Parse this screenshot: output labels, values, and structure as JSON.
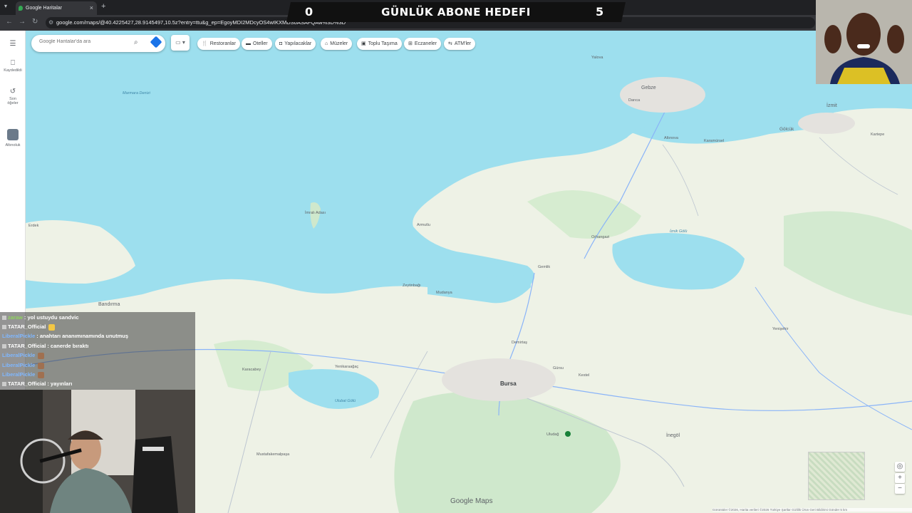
{
  "browser": {
    "tab_title": "Google Haritalar",
    "url_main": "google.com/maps/@40.4225427,28.9145497,10.5z?entry=ttu&g_ep=EgoyMDI2MDcyOS4wIKXMDSoASAFQAw%3D%3D"
  },
  "overlay": {
    "goal_current": "0",
    "goal_title": "GÜNLÜK ABONE HEDEFI",
    "goal_target": "5"
  },
  "rail": {
    "menu": "",
    "saved": "Kaydedildi",
    "recent_line1": "Son",
    "recent_line2": "öğeler",
    "app": "Altınoluk"
  },
  "search": {
    "placeholder": "Google Haritalar'da ara"
  },
  "chips": [
    {
      "label": "Restoranlar",
      "icon": "fork-knife-icon"
    },
    {
      "label": "Oteller",
      "icon": "bed-icon"
    },
    {
      "label": "Yapılacaklar",
      "icon": "camera-icon"
    },
    {
      "label": "Müzeler",
      "icon": "museum-icon"
    },
    {
      "label": "Toplu Taşıma",
      "icon": "train-icon"
    },
    {
      "label": "Eczaneler",
      "icon": "pharmacy-icon"
    },
    {
      "label": "ATM'ler",
      "icon": "atm-icon"
    }
  ],
  "map": {
    "cities": {
      "bursa": "Bursa",
      "izmit": "İzmit",
      "gebze": "Gebze",
      "bandirma": "Bandırma",
      "inegol": "İnegöl",
      "golcuk": "Gölcük"
    },
    "places": {
      "marmara_denizi": "Marmara Denizi",
      "imrali": "İmralı Adası",
      "mudanya": "Mudanya",
      "gemlik": "Gemlik",
      "yalova": "Yalova",
      "uludag": "Uludağ",
      "iznik_golu": "İznik Gölü",
      "ulubat_golu": "Ulubat Gölü",
      "armutlu": "Armutlu",
      "karacabey": "Karacabey",
      "orhangazi": "Orhangazi",
      "gursu": "Gürsu",
      "kestel": "Kestel",
      "yenisehir": "Yenişehir",
      "mustafakemalpasa": "Mustafakemalpaşa",
      "kartepe": "Kartepe",
      "erdek": "Erdek",
      "darica": "Darıca",
      "karamursel": "Karamürsel",
      "altinova": "Altınova",
      "tavsanli": "Yenikaraağaç",
      "osmangazi": "Demirtaş",
      "zeytinbagi": "Zeytinbağı"
    },
    "logo": "Google Maps",
    "attribution": "Görüntüler ©2026, Harita verileri ©2026   Türkiye   Şartlar   Gizlilik   Ürün Geri Bildirimi Gönder   5 km"
  },
  "chat": [
    {
      "user": "zaraw",
      "user_color": "green",
      "msg": ": yol ustuydu sandvic",
      "emote": false
    },
    {
      "user": "TATAR_Official",
      "user_color": "white",
      "msg": "",
      "emote": true
    },
    {
      "user": "LiberalPickle",
      "user_color": "blue",
      "msg": ": anahtarı ananımınamında unutmuş",
      "emote": false
    },
    {
      "user": "TATAR_Official",
      "user_color": "white",
      "msg": ": canerde bıraktı",
      "emote": false
    },
    {
      "user": "LiberalPickle",
      "user_color": "blue",
      "msg": "",
      "emote": true
    },
    {
      "user": "LiberalPickle",
      "user_color": "blue",
      "msg": "",
      "emote": true
    },
    {
      "user": "LiberalPickle",
      "user_color": "blue",
      "msg": "",
      "emote": true
    },
    {
      "user": "TATAR_Official",
      "user_color": "white",
      "msg": ": yayınları",
      "emote": false
    }
  ],
  "colors": {
    "water": "#9ddfee",
    "land": "#e8f0e4",
    "green": "#c6e6c8",
    "road_major": "#8ab4f8"
  }
}
